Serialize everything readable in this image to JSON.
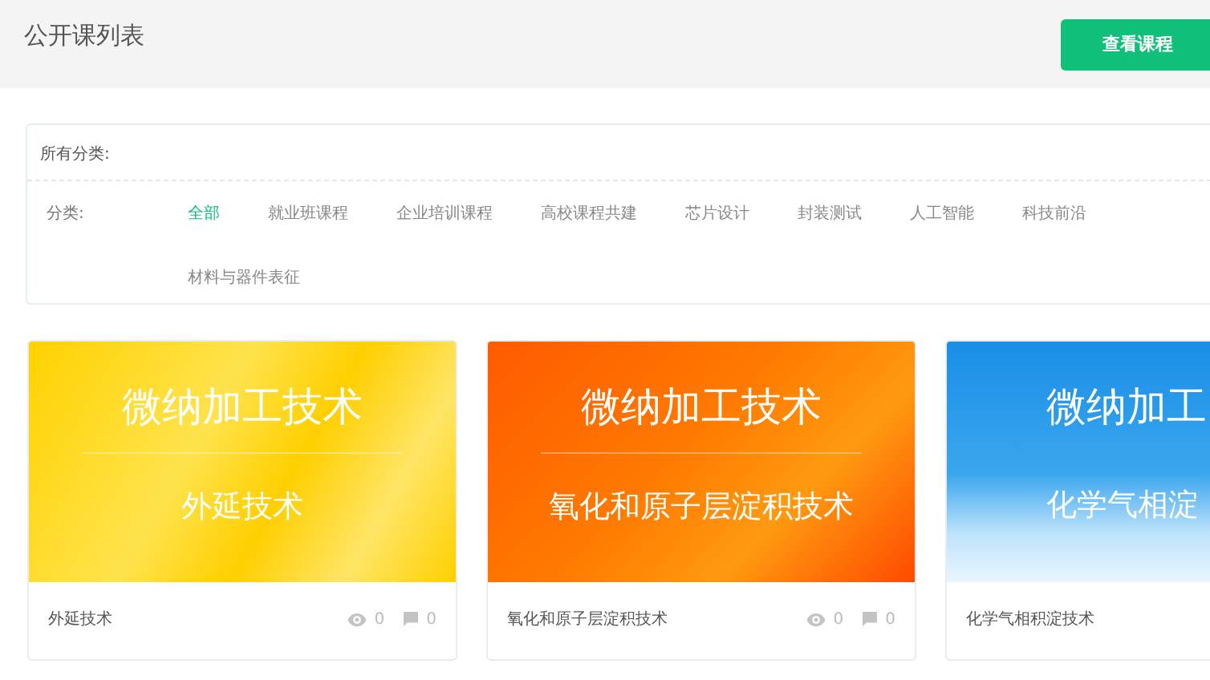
{
  "header": {
    "title": "公开课列表",
    "button": "查看课程"
  },
  "filter": {
    "all_label": "所有分类:",
    "category_label": "分类:",
    "categories": [
      {
        "label": "全部",
        "selected": true
      },
      {
        "label": "就业班课程",
        "selected": false
      },
      {
        "label": "企业培训课程",
        "selected": false
      },
      {
        "label": "高校课程共建",
        "selected": false
      },
      {
        "label": "芯片设计",
        "selected": false
      },
      {
        "label": "封装测试",
        "selected": false
      },
      {
        "label": "人工智能",
        "selected": false
      },
      {
        "label": "科技前沿",
        "selected": false
      },
      {
        "label": "材料与器件表征",
        "selected": false
      }
    ]
  },
  "courses": [
    {
      "kind": "yellow",
      "banner_title": "微纳加工技术",
      "banner_subtitle": "外延技术",
      "title": "外延技术",
      "views": "0",
      "comments": "0"
    },
    {
      "kind": "orange",
      "banner_title": "微纳加工技术",
      "banner_subtitle": "氧化和原子层淀积技术",
      "title": "氧化和原子层淀积技术",
      "views": "0",
      "comments": "0"
    },
    {
      "kind": "blue",
      "banner_title": "微纳加工",
      "banner_subtitle": "化学气相淀",
      "title": "化学气相积淀技术"
    }
  ]
}
